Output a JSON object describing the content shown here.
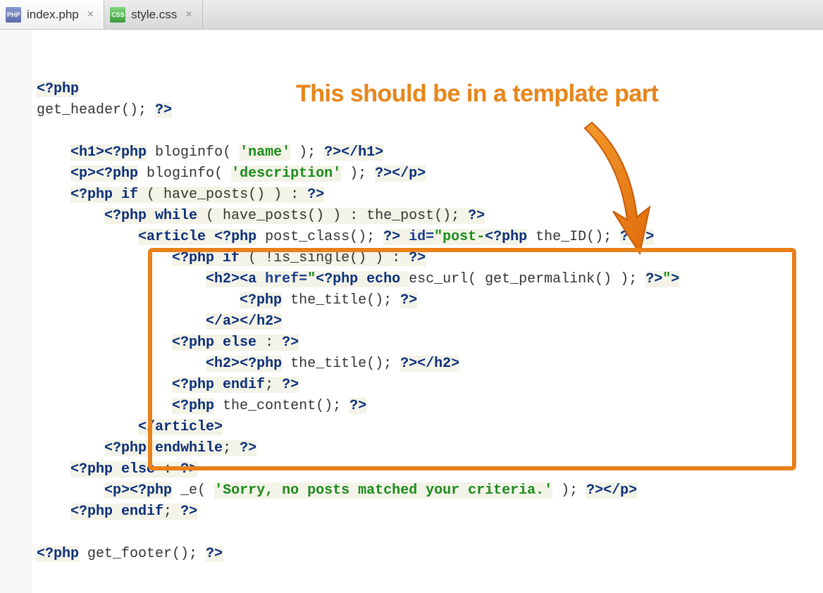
{
  "tabs": [
    {
      "label": "index.php",
      "icon_text": "PHP",
      "icon_class": "php",
      "active": true
    },
    {
      "label": "style.css",
      "icon_text": "CSS",
      "icon_class": "css",
      "active": false
    }
  ],
  "annotation_text": "This should be in a template part",
  "code": {
    "l1_open": "<?php",
    "l2_func": "get_header(); ",
    "l2_close": "?>",
    "l4a": "<h1>",
    "l4b": "<?php",
    "l4c": " bloginfo( ",
    "l4d": "'name'",
    "l4e": " ); ",
    "l4f": "?>",
    "l4g": "</h1>",
    "l5a": "<p>",
    "l5b": "<?php",
    "l5c": " bloginfo( ",
    "l5d": "'description'",
    "l5e": " ); ",
    "l5f": "?>",
    "l5g": "</p>",
    "l6a": "<?php",
    "l6b": " if ",
    "l6c": "( have_posts() ) : ",
    "l6d": "?>",
    "l7a": "<?php",
    "l7b": " while ",
    "l7c": "( have_posts() ) : the_post(); ",
    "l7d": "?>",
    "l8a": "<article ",
    "l8b": "<?php",
    "l8c": " post_class(); ",
    "l8d": "?>",
    "l8e": " id=",
    "l8f": "\"post-",
    "l8g": "<?php",
    "l8h": " the_ID(); ",
    "l8i": "?>",
    "l8j": "\"",
    "l8k": ">",
    "l9a": "<?php",
    "l9b": " if ",
    "l9c": "( !is_single() ) : ",
    "l9d": "?>",
    "l10a": "<h2>",
    "l10b": "<a ",
    "l10c": "href=",
    "l10d": "\"",
    "l10e": "<?php",
    "l10f": " echo ",
    "l10g": "esc_url( get_permalink() ); ",
    "l10h": "?>",
    "l10i": "\"",
    "l10j": ">",
    "l11a": "<?php",
    "l11b": " the_title(); ",
    "l11c": "?>",
    "l12a": "</a>",
    "l12b": "</h2>",
    "l13a": "<?php",
    "l13b": " else ",
    "l13c": ": ",
    "l13d": "?>",
    "l14a": "<h2>",
    "l14b": "<?php",
    "l14c": " the_title(); ",
    "l14d": "?>",
    "l14e": "</h2>",
    "l15a": "<?php",
    "l15b": " endif",
    "l15c": "; ",
    "l15d": "?>",
    "l16a": "<?php",
    "l16b": " the_content(); ",
    "l16c": "?>",
    "l17a": "</article>",
    "l18a": "<?php",
    "l18b": " endwhile",
    "l18c": "; ",
    "l18d": "?>",
    "l19a": "<?php",
    "l19b": " else ",
    "l19c": ": ",
    "l19d": "?>",
    "l20a": "<p>",
    "l20b": "<?php",
    "l20c": " _e( ",
    "l20d": "'Sorry, no posts matched your criteria.'",
    "l20e": " ); ",
    "l20f": "?>",
    "l20g": "</p>",
    "l21a": "<?php",
    "l21b": " endif",
    "l21c": "; ",
    "l21d": "?>",
    "l23a": "<?php",
    "l23b": " get_footer(); ",
    "l23c": "?>"
  }
}
